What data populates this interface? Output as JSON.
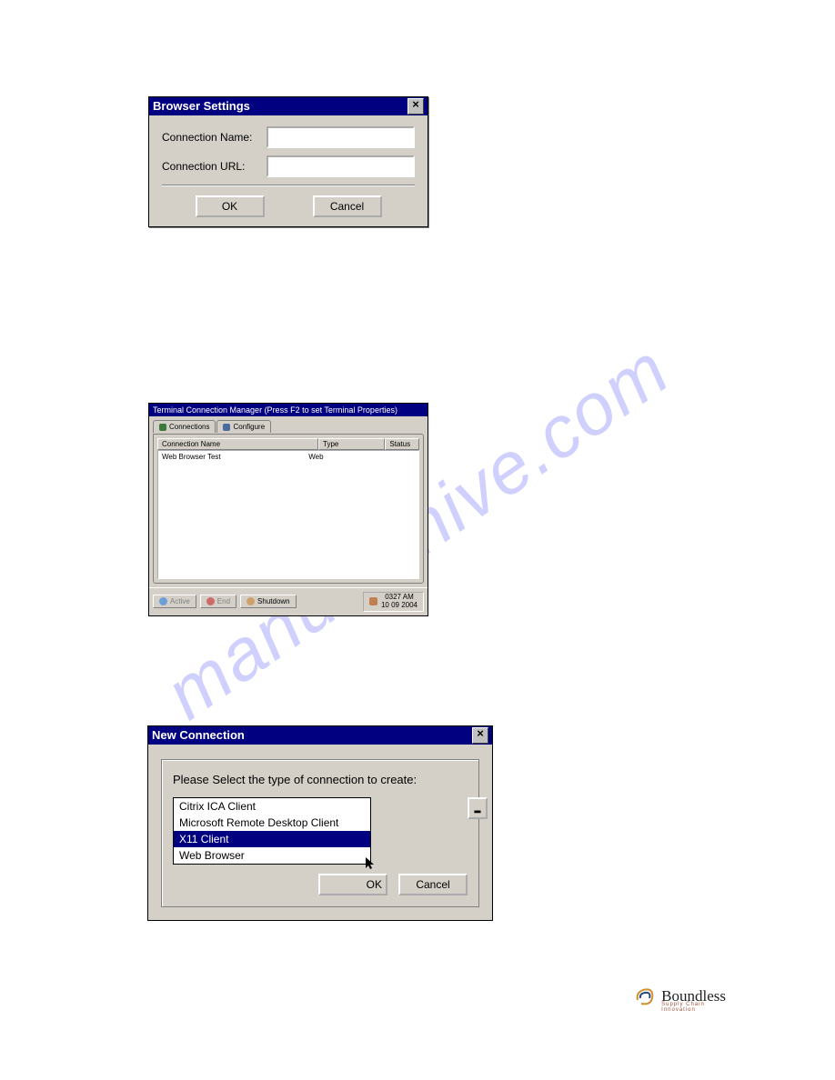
{
  "watermark": "manualshive.com",
  "dialog1": {
    "title": "Browser Settings",
    "label_name": "Connection Name:",
    "label_url": "Connection URL:",
    "value_name": "",
    "value_url": "",
    "ok": "OK",
    "cancel": "Cancel"
  },
  "dialog2": {
    "title": "Terminal Connection Manager (Press F2 to set Terminal Properties)",
    "tabs": {
      "connections": "Connections",
      "configure": "Configure"
    },
    "headers": {
      "name": "Connection Name",
      "type": "Type",
      "status": "Status"
    },
    "rows": [
      {
        "name": "Web Browser Test",
        "type": "Web",
        "status": ""
      }
    ],
    "buttons": {
      "active": "Active",
      "end": "End",
      "shutdown": "Shutdown"
    },
    "clock": {
      "time": "0327 AM",
      "date": "10 09 2004"
    }
  },
  "dialog3": {
    "title": "New Connection",
    "prompt": "Please Select the type of connection to create:",
    "options": [
      "Citrix ICA Client",
      "Microsoft Remote Desktop Client",
      "X11 Client",
      "Web Browser"
    ],
    "selected_index": 2,
    "ok": "OK",
    "cancel": "Cancel"
  },
  "brand": {
    "name": "Boundless",
    "tag": "Supply Chain Innovation"
  }
}
